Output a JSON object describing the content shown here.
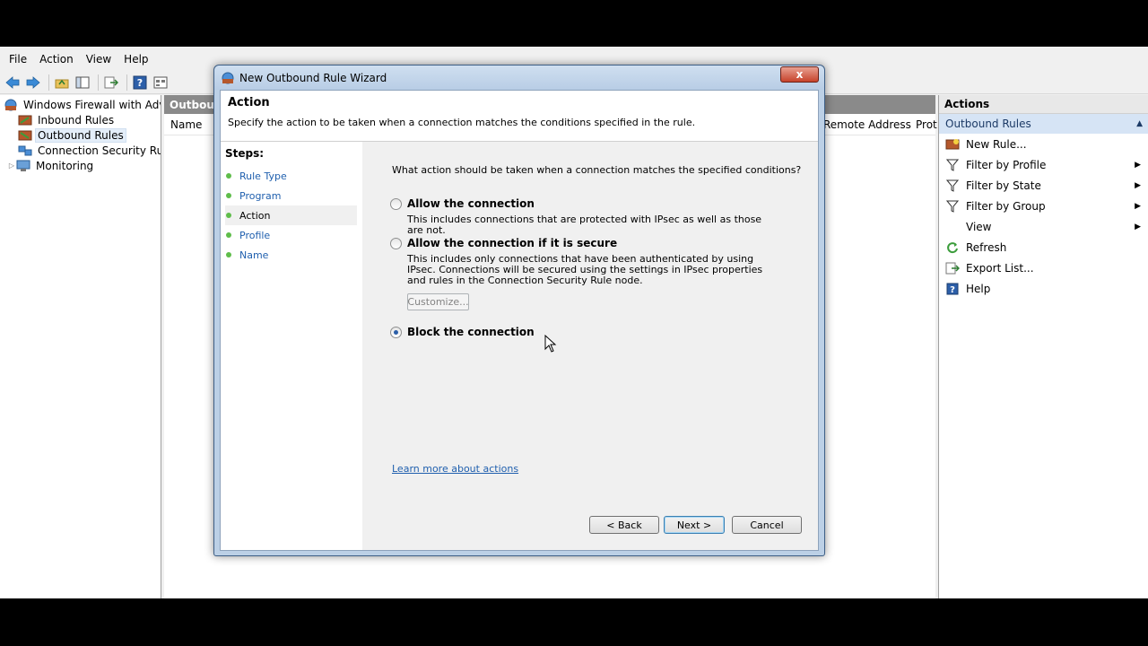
{
  "menu": [
    "File",
    "Action",
    "View",
    "Help"
  ],
  "tree": {
    "root": "Windows Firewall with Advance",
    "items": [
      {
        "label": "Inbound Rules"
      },
      {
        "label": "Outbound Rules"
      },
      {
        "label": "Connection Security Rules"
      },
      {
        "label": "Monitoring"
      }
    ]
  },
  "middle": {
    "header": "Outbound",
    "col_name": "Name",
    "col_remote": "Remote Address",
    "col_prot": "Prot"
  },
  "actions": {
    "title": "Actions",
    "section": "Outbound Rules",
    "items": [
      {
        "label": "New Rule..."
      },
      {
        "label": "Filter by Profile"
      },
      {
        "label": "Filter by State"
      },
      {
        "label": "Filter by Group"
      },
      {
        "label": "View"
      },
      {
        "label": "Refresh"
      },
      {
        "label": "Export List..."
      },
      {
        "label": "Help"
      }
    ]
  },
  "dialog": {
    "title": "New Outbound Rule Wizard",
    "close": "x",
    "heading": "Action",
    "subtitle": "Specify the action to be taken when a connection matches the conditions specified in the rule.",
    "steps_title": "Steps:",
    "steps": [
      "Rule Type",
      "Program",
      "Action",
      "Profile",
      "Name"
    ],
    "question": "What action should be taken when a connection matches the specified conditions?",
    "options": [
      {
        "label": "Allow the connection",
        "desc": "This includes connections that are protected with IPsec as well as those are not.",
        "checked": false
      },
      {
        "label": "Allow the connection if it is secure",
        "desc": "This includes only connections that have been authenticated by using IPsec.  Connections will be secured using the settings in IPsec properties and rules in the Connection Security Rule node.",
        "checked": false
      },
      {
        "label": "Block the connection",
        "checked": true
      }
    ],
    "customize": "Customize...",
    "learn_more": "Learn more about actions",
    "back": "< Back",
    "next": "Next >",
    "cancel": "Cancel"
  }
}
